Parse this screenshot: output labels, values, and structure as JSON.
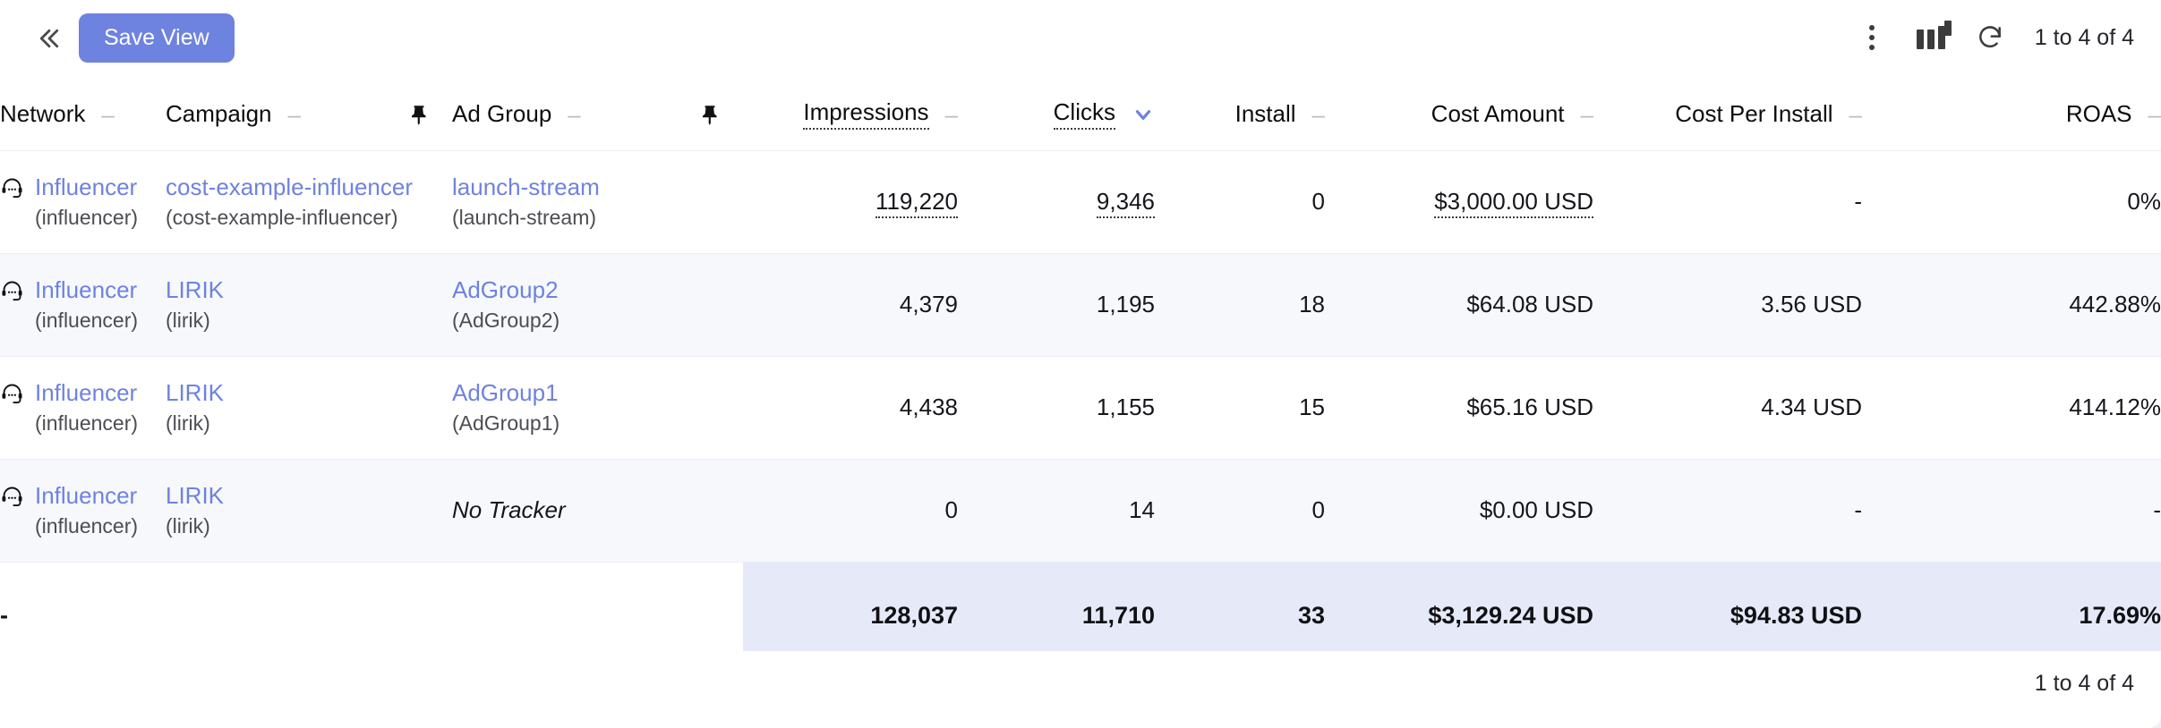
{
  "toolbar": {
    "collapse_icon": "chevron-double-left-icon",
    "save_view_label": "Save View",
    "menu_icon": "kebab-menu-icon",
    "columns_icon": "bar-chart-icon",
    "refresh_icon": "refresh-icon",
    "pagination": "1 to 4 of 4"
  },
  "columns": [
    {
      "label": "Network",
      "icon": "minus-icon",
      "align": "left"
    },
    {
      "label": "Campaign",
      "icon": "minus-icon",
      "align": "left"
    },
    {
      "label": "",
      "icon": "pin-icon",
      "align": "center"
    },
    {
      "label": "Ad Group",
      "icon": "minus-icon",
      "align": "left"
    },
    {
      "label": "",
      "icon": "pin-icon",
      "align": "center"
    },
    {
      "label": "Impressions",
      "icon": "minus-icon",
      "align": "right"
    },
    {
      "label": "Clicks",
      "icon": "chevron-down-icon",
      "align": "right",
      "sorted": true
    },
    {
      "label": "Install",
      "icon": "minus-icon",
      "align": "right"
    },
    {
      "label": "Cost Amount",
      "icon": "minus-icon",
      "align": "right"
    },
    {
      "label": "Cost Per Install",
      "icon": "minus-icon",
      "align": "right"
    },
    {
      "label": "ROAS",
      "icon": "minus-icon",
      "align": "right"
    }
  ],
  "rows": [
    {
      "network_icon": "headset-icon",
      "network": "Influencer",
      "network_sub": "(influencer)",
      "campaign": "cost-example-influencer",
      "campaign_sub": "(cost-example-influencer)",
      "ad_group": "launch-stream",
      "ad_group_sub": "(launch-stream)",
      "impressions": "119,220",
      "clicks": "9,346",
      "install": "0",
      "cost_amount": "$3,000.00 USD",
      "cost_per_install": "-",
      "roas": "0%"
    },
    {
      "network_icon": "headset-icon",
      "network": "Influencer",
      "network_sub": "(influencer)",
      "campaign": "LIRIK",
      "campaign_sub": "(lirik)",
      "ad_group": "AdGroup2",
      "ad_group_sub": "(AdGroup2)",
      "impressions": "4,379",
      "clicks": "1,195",
      "install": "18",
      "cost_amount": "$64.08 USD",
      "cost_per_install": "3.56 USD",
      "roas": "442.88%"
    },
    {
      "network_icon": "headset-icon",
      "network": "Influencer",
      "network_sub": "(influencer)",
      "campaign": "LIRIK",
      "campaign_sub": "(lirik)",
      "ad_group": "AdGroup1",
      "ad_group_sub": "(AdGroup1)",
      "impressions": "4,438",
      "clicks": "1,155",
      "install": "15",
      "cost_amount": "$65.16 USD",
      "cost_per_install": "4.34 USD",
      "roas": "414.12%"
    },
    {
      "network_icon": "headset-icon",
      "network": "Influencer",
      "network_sub": "(influencer)",
      "campaign": "LIRIK",
      "campaign_sub": "(lirik)",
      "ad_group": "No Tracker",
      "ad_group_sub": "",
      "impressions": "0",
      "clicks": "14",
      "install": "0",
      "cost_amount": "$0.00 USD",
      "cost_per_install": "-",
      "roas": "-"
    }
  ],
  "totals": {
    "network": "-",
    "campaign": "",
    "ad_group": "",
    "impressions": "128,037",
    "clicks": "11,710",
    "install": "33",
    "cost_amount": "$3,129.24 USD",
    "cost_per_install": "$94.83 USD",
    "roas": "17.69%"
  },
  "footer": {
    "pagination": "1 to 4 of 4"
  },
  "colors": {
    "accent": "#6e82e0",
    "link": "#6e82e0",
    "stripe": "#f6f8fc",
    "totals_highlight": "#e6eaf8",
    "notification": "#dc4343",
    "page_background": "#eef0f6"
  }
}
